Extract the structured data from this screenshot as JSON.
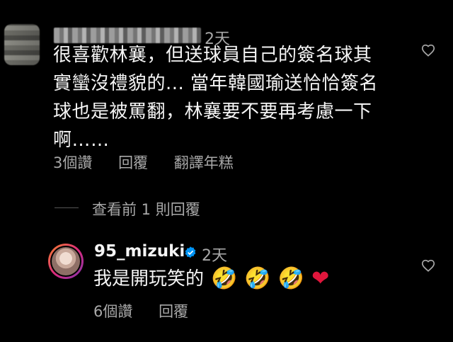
{
  "comment": {
    "time": "2天",
    "text": "很喜歡林襄，但送球員自己的簽名球其\n實蠻沒禮貌的... 當年韓國瑜送恰恰簽名\n球也是被罵翻，林襄要不要再考慮一下\n啊……",
    "likes": "3個讚",
    "reply_label": "回覆",
    "translate_label": "翻譯年糕"
  },
  "view_replies": "查看前 1 則回覆",
  "reply": {
    "username": "95_mizuki",
    "time": "2天",
    "text": "我是開玩笑的",
    "emojis": [
      "🤣",
      "🤣",
      "🤣",
      "❤"
    ],
    "likes": "6個讚",
    "reply_label": "回覆"
  },
  "icons": {
    "like": "heart-outline-icon",
    "verified": "verified-badge-icon"
  },
  "colors": {
    "background": "#000000",
    "primary_text": "#f5f5f5",
    "secondary_text": "#a8a8a8",
    "verified": "#0095f6",
    "heart_emoji": "#e0163c"
  }
}
